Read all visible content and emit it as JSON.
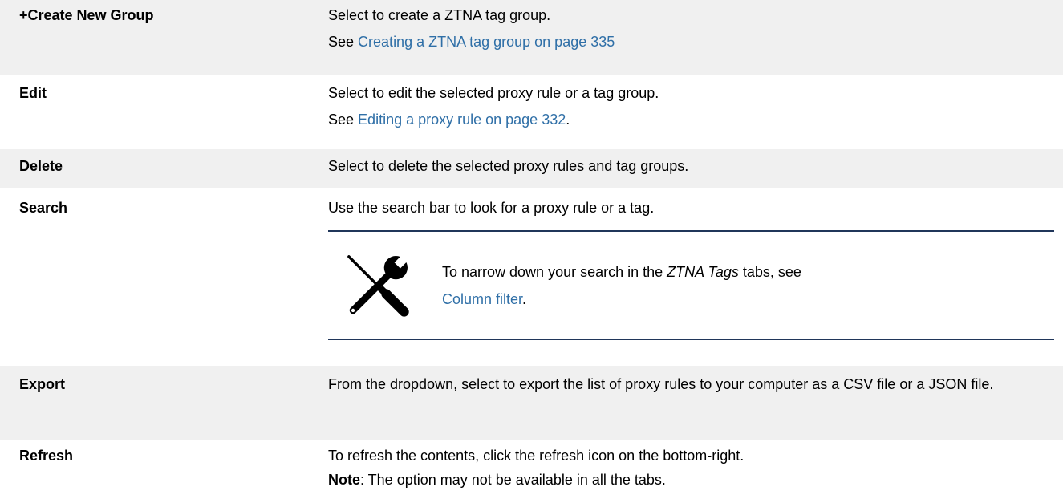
{
  "rows": [
    {
      "term": "+Create New Group",
      "desc_line1": "Select to create a ZTNA tag group.",
      "see_prefix": "See",
      "see_link": "Creating a ZTNA tag group on page 335"
    },
    {
      "term": "Edit",
      "desc_line1": "Select to edit the selected proxy rule or a tag group.",
      "see_prefix": "See",
      "see_link": "Editing a proxy rule on page 332",
      "see_suffix": "."
    },
    {
      "term": "Delete",
      "desc_line1": "Select to delete the selected proxy rules and tag groups."
    },
    {
      "term": "Search",
      "desc_line1": "Use the search bar to look for a proxy rule or a tag.",
      "note": {
        "icon": "tools-icon",
        "text_before": "To narrow down your search in the",
        "text_italic": "ZTNA Tags",
        "text_after": "tabs, see",
        "link": "Column filter",
        "link_suffix": "."
      }
    },
    {
      "term": "Export",
      "desc_line1": "From the dropdown, select to export the list of proxy rules to your computer as a CSV file or a JSON file."
    },
    {
      "term": "Refresh",
      "desc_line1": "To refresh the contents, click the refresh icon on the bottom-right.",
      "note_label": "Note",
      "note_rest": ": The option may not be available in all the tabs."
    }
  ],
  "colors": {
    "link": "#2f6fa7",
    "shaded_row": "#f0f0f0",
    "rule": "#20365a"
  }
}
